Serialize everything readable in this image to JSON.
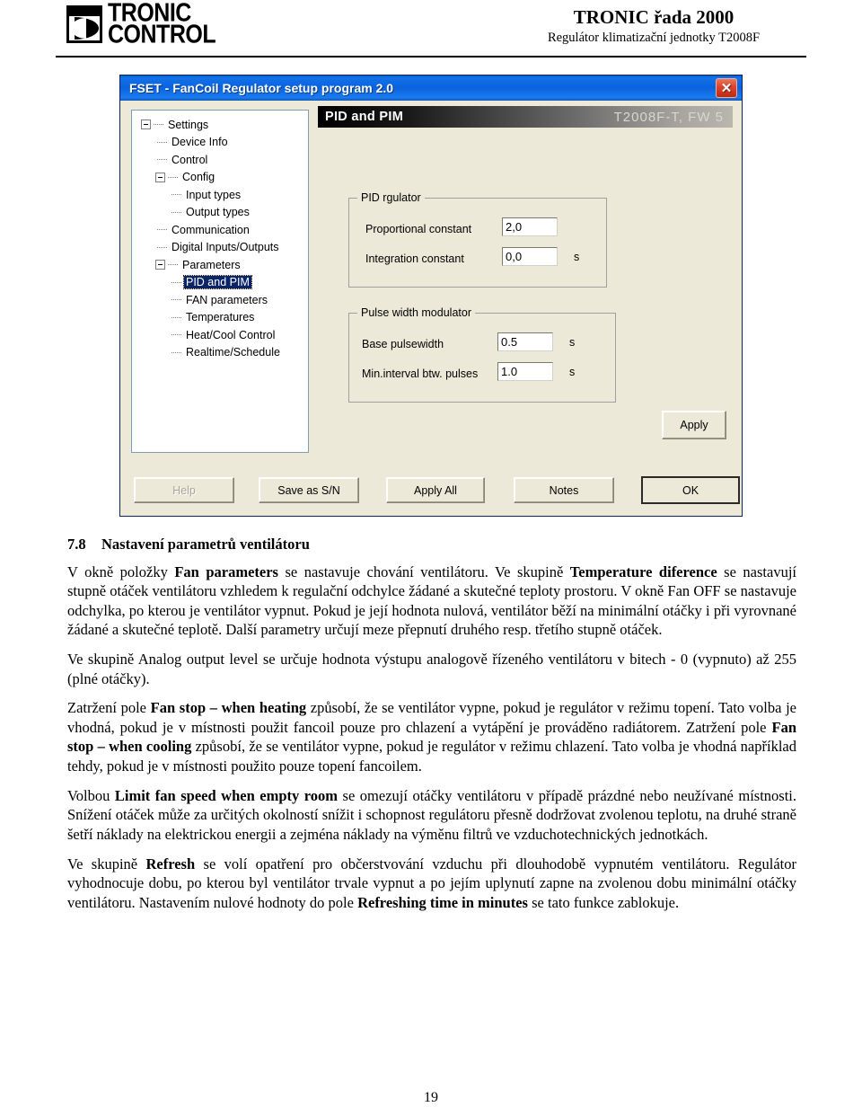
{
  "header": {
    "logo_line1": "TRONIC",
    "logo_line2": "CONTROL",
    "brand_title": "TRONIC řada 2000",
    "brand_subtitle": "Regulátor klimatizační jednotky T2008F"
  },
  "app": {
    "title": "FSET - FanCoil Regulator setup program 2.0",
    "close_label": "✕",
    "band": {
      "left": "PID and PIM",
      "right": "T2008F-T, FW 5"
    },
    "tree": [
      {
        "label": "Settings",
        "level": 0,
        "expander": "minus"
      },
      {
        "label": "Device Info",
        "level": 1,
        "expander": "none"
      },
      {
        "label": "Control",
        "level": 1,
        "expander": "none"
      },
      {
        "label": "Config",
        "level": 1,
        "expander": "minus"
      },
      {
        "label": "Input types",
        "level": 2,
        "expander": "none"
      },
      {
        "label": "Output types",
        "level": 2,
        "expander": "none"
      },
      {
        "label": "Communication",
        "level": 1,
        "expander": "none"
      },
      {
        "label": "Digital Inputs/Outputs",
        "level": 1,
        "expander": "none"
      },
      {
        "label": "Parameters",
        "level": 1,
        "expander": "minus"
      },
      {
        "label": "PID and PIM",
        "level": 2,
        "expander": "none",
        "selected": true
      },
      {
        "label": "FAN parameters",
        "level": 2,
        "expander": "none"
      },
      {
        "label": "Temperatures",
        "level": 2,
        "expander": "none"
      },
      {
        "label": "Heat/Cool Control",
        "level": 2,
        "expander": "none"
      },
      {
        "label": "Realtime/Schedule",
        "level": 2,
        "expander": "none"
      }
    ],
    "pid_group": {
      "title": "PID rgulator",
      "proportional_label": "Proportional constant",
      "proportional_value": "2,0",
      "integration_label": "Integration constant",
      "integration_value": "0,0",
      "integration_unit": "s"
    },
    "pwm_group": {
      "title": "Pulse width modulator",
      "base_label": "Base pulsewidth",
      "base_value": "0.5",
      "base_unit": "s",
      "interval_label": "Min.interval btw. pulses",
      "interval_value": "1.0",
      "interval_unit": "s"
    },
    "buttons": {
      "apply": "Apply",
      "help": "Help",
      "save_as_sn": "Save as S/N",
      "apply_all": "Apply All",
      "notes": "Notes",
      "ok": "OK"
    }
  },
  "document": {
    "section_number": "7.8",
    "section_title": "Nastavení parametrů ventilátoru",
    "p1_a": "V okně položky ",
    "p1_b1": "Fan parameters",
    "p1_c": " se nastavuje chování ventilátoru. Ve skupině ",
    "p1_b2": "Temperature diference",
    "p1_d": " se nastavují stupně otáček ventilátoru vzhledem k regulační odchylce žádané a skutečné teploty prostoru. V okně Fan OFF se nastavuje odchylka, po kterou je ventilátor vypnut. Pokud je její hodnota nulová, ventilátor běží na minimální otáčky i při vyrovnané žádané a skutečné teplotě. Další parametry určují meze přepnutí druhého resp. třetího stupně otáček.",
    "p2": "Ve skupině Analog output level se určuje hodnota výstupu analogově řízeného ventilátoru v bitech - 0 (vypnuto) až 255 (plné otáčky).",
    "p3_a": "Zatržení pole ",
    "p3_b1": "Fan stop – when heating",
    "p3_c": " způsobí, že se ventilátor vypne, pokud je regulátor v režimu topení. Tato volba je vhodná, pokud je v místnosti použit fancoil pouze pro chlazení a vytápění je prováděno radiátorem. Zatržení pole ",
    "p3_b2": "Fan stop – when cooling",
    "p3_d": " způsobí, že se ventilátor vypne, pokud je regulátor v režimu chlazení. Tato volba je vhodná například tehdy, pokud je v místnosti použito pouze topení fancoilem.",
    "p4_a": "Volbou ",
    "p4_b1": "Limit fan speed when empty room",
    "p4_c": " se omezují otáčky ventilátoru v případě prázdné nebo neužívané místnosti. Snížení otáček může za určitých okolností snížit i schopnost regulátoru přesně dodržovat zvolenou teplotu, na druhé straně šetří náklady na elektrickou energii a zejména náklady na výměnu filtrů ve vzduchotechnických jednotkách.",
    "p5_a": "Ve skupině ",
    "p5_b1": "Refresh",
    "p5_c": " se volí opatření pro občerstvování vzduchu při dlouhodobě vypnutém ventilátoru. Regulátor vyhodnocuje dobu, po kterou byl ventilátor trvale vypnut a po jejím uplynutí zapne na zvolenou dobu minimální otáčky ventilátoru. Nastavením nulové hodnoty do pole ",
    "p5_b2": "Refreshing time in minutes",
    "p5_d": " se tato funkce zablokuje.",
    "page_number": "19"
  }
}
